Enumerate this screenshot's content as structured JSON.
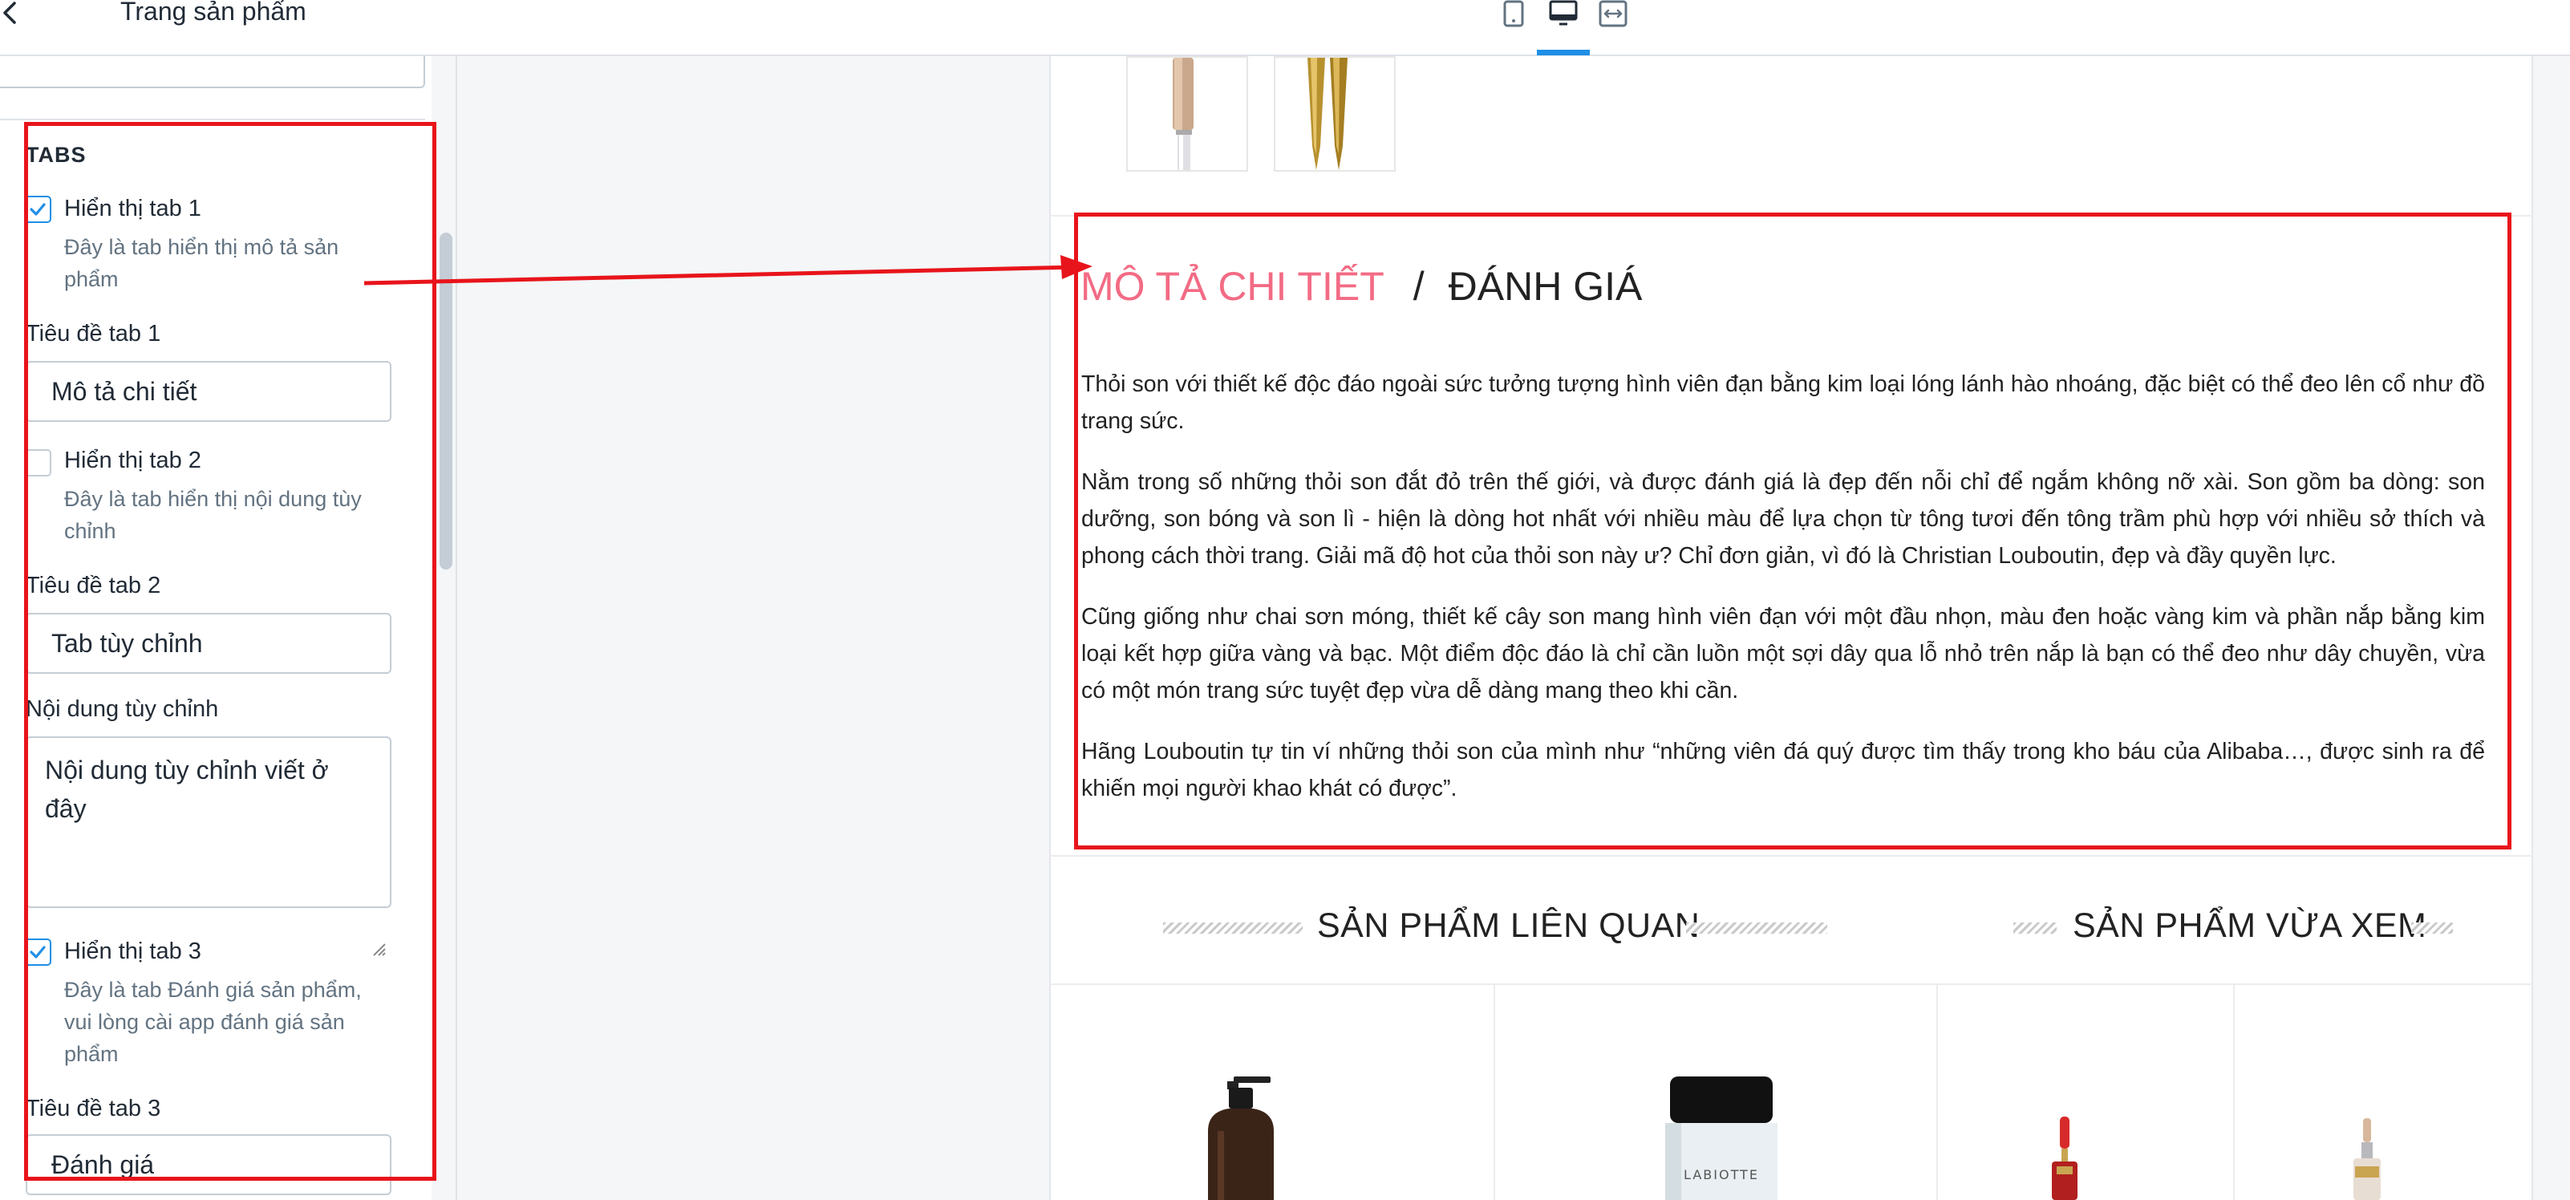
{
  "header": {
    "back_icon": "chevron-left-icon",
    "sidebar_title": "Trang sản phẩm",
    "device_icons": [
      "mobile-icon",
      "desktop-icon",
      "fullwidth-icon"
    ],
    "active_device": "desktop",
    "accent_color": "#1f8fe6"
  },
  "sidebar": {
    "section_heading": "TABS",
    "tab1": {
      "show_label": "Hiển thị tab 1",
      "show_checked": true,
      "help": "Đây là tab hiển thị mô tả sản phẩm",
      "title_label": "Tiêu đề tab 1",
      "title_value": "Mô tả chi tiết"
    },
    "tab2": {
      "show_label": "Hiển thị tab 2",
      "show_checked": false,
      "help": "Đây là tab hiển thị nội dung tùy chỉnh",
      "title_label": "Tiêu đề tab 2",
      "title_value": "Tab tùy chỉnh",
      "content_label": "Nội dung tùy chỉnh",
      "content_value": "Nội dung tùy chỉnh viết ở đây"
    },
    "tab3": {
      "show_label": "Hiển thị tab 3",
      "show_checked": true,
      "help": "Đây là tab Đánh giá sản phẩm, vui lòng cài app đánh giá sản phẩm",
      "title_label": "Tiêu đề tab 3",
      "title_value": "Đánh giá"
    }
  },
  "annotation": {
    "color": "#e8141b"
  },
  "preview": {
    "tabs": {
      "active": "MÔ TẢ CHI TIẾT",
      "separator": "/",
      "inactive": "ĐÁNH GIÁ",
      "active_color": "#f36b84"
    },
    "description": [
      "Thỏi son với thiết kế độc đáo ngoài sức tưởng tượng hình viên đạn bằng kim loại lóng lánh hào nhoáng, đặc biệt có thể đeo lên cổ như đồ trang sức.",
      "Nằm trong số những thỏi son đắt đỏ trên thế giới, và được đánh giá là đẹp đến nỗi chỉ để ngắm không nỡ xài. Son gồm ba dòng: son dưỡng, son bóng và son lì - hiện là dòng hot nhất với nhiều màu để lựa chọn từ tông tươi đến tông trầm phù hợp với nhiều sở thích và phong cách thời trang. Giải mã độ hot của thỏi son này ư? Chỉ đơn giản, vì đó là Christian Louboutin, đẹp và đầy quyền lực.",
      "Cũng giống như chai sơn móng, thiết kế cây son mang hình viên đạn với một đầu nhọn, màu đen hoặc vàng kim và phần nắp bằng kim loại kết hợp giữa vàng và bạc. Một điểm độc đáo là chỉ cần luồn một sợi dây qua lỗ nhỏ trên nắp là bạn có thể đeo như dây chuyền, vừa có một món trang sức tuyệt đẹp vừa dễ dàng mang theo khi cần.",
      "Hãng Louboutin tự tin ví những thỏi son của mình như “những viên đá quý được tìm thấy trong kho báu của Alibaba…, được sinh ra để khiến mọi người khao khát có được”."
    ],
    "related_title": "SẢN PHẨM LIÊN QUAN",
    "recent_title": "SẢN PHẨM VỪA XEM",
    "bottle_brand": "LABIOTTE"
  }
}
